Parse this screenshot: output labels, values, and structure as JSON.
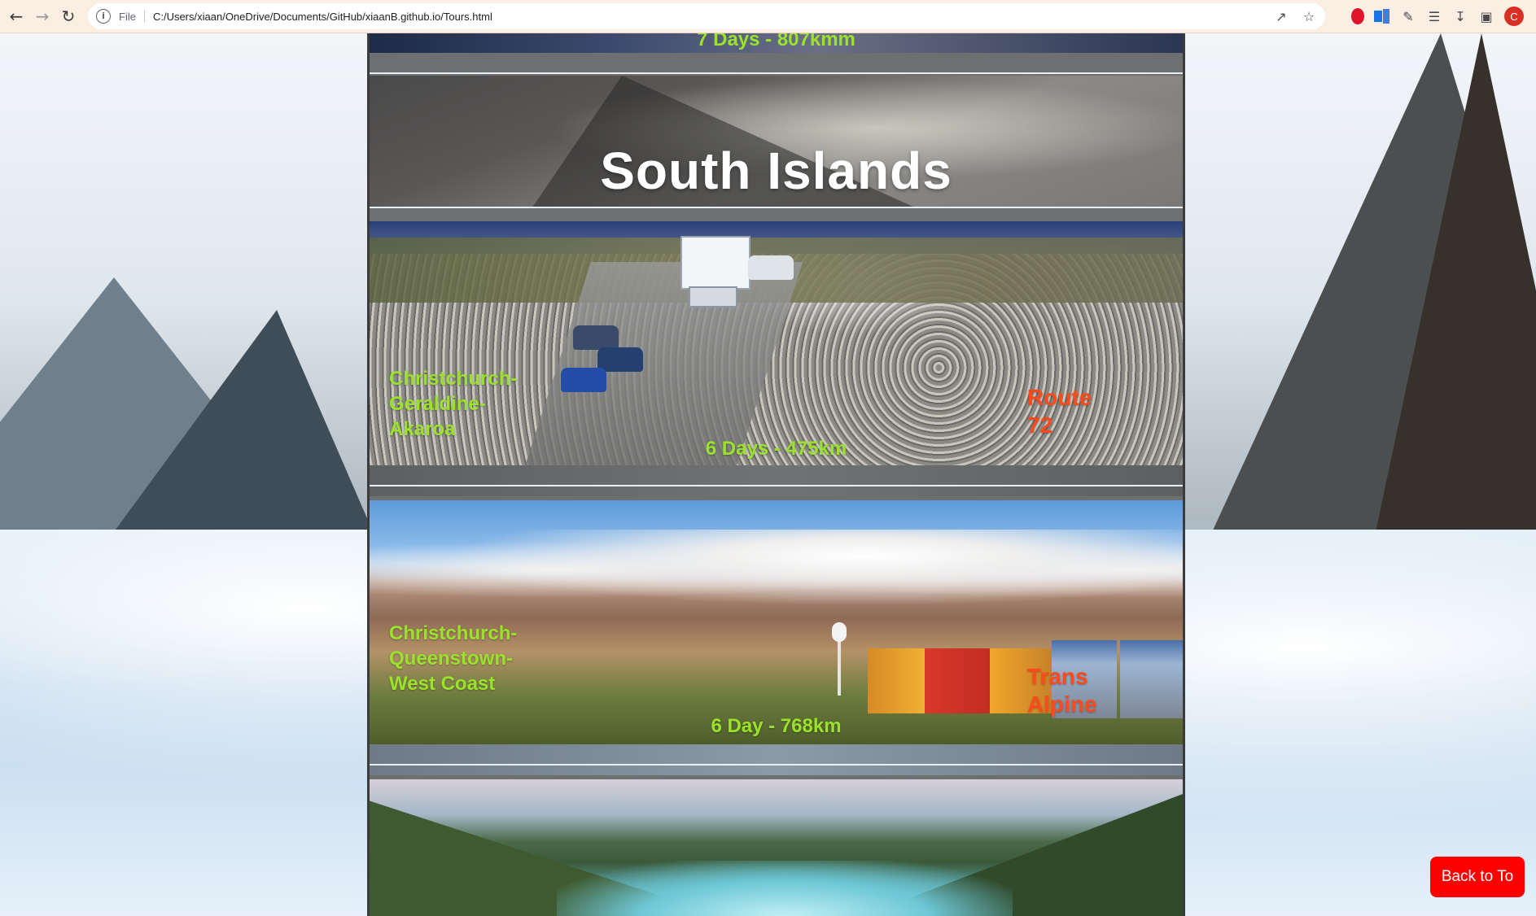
{
  "browser": {
    "scheme_label": "File",
    "url": "C:/Users/xiaan/OneDrive/Documents/GitHub/xiaanB.github.io/Tours.html",
    "profile_initial": "C",
    "icons": [
      "back-arrow-icon",
      "forward-arrow-icon",
      "reload-icon",
      "info-icon",
      "share-icon",
      "bookmark-star-icon",
      "opera-extension-icon",
      "translate-extension-icon",
      "extensions-puzzle-icon",
      "reading-list-icon",
      "download-icon",
      "side-panel-icon"
    ]
  },
  "page": {
    "previous_tour_duration": "7 Days - 807kmm",
    "section_title": "South Islands",
    "tours": [
      {
        "route": "Christchurch-Geraldine-Akaroa",
        "name": "Route 72",
        "duration": "6 Days - 475km"
      },
      {
        "route": "Christchurch-Queenstown-West Coast",
        "name": "Trans Alpine",
        "duration": "6 Day - 768km"
      }
    ],
    "back_to_top_label": "Back to To"
  },
  "colors": {
    "route_text": "#9be22d",
    "tour_name_text": "#ff4a1c",
    "back_button": "#ff0000",
    "title_text": "#ffffff"
  }
}
